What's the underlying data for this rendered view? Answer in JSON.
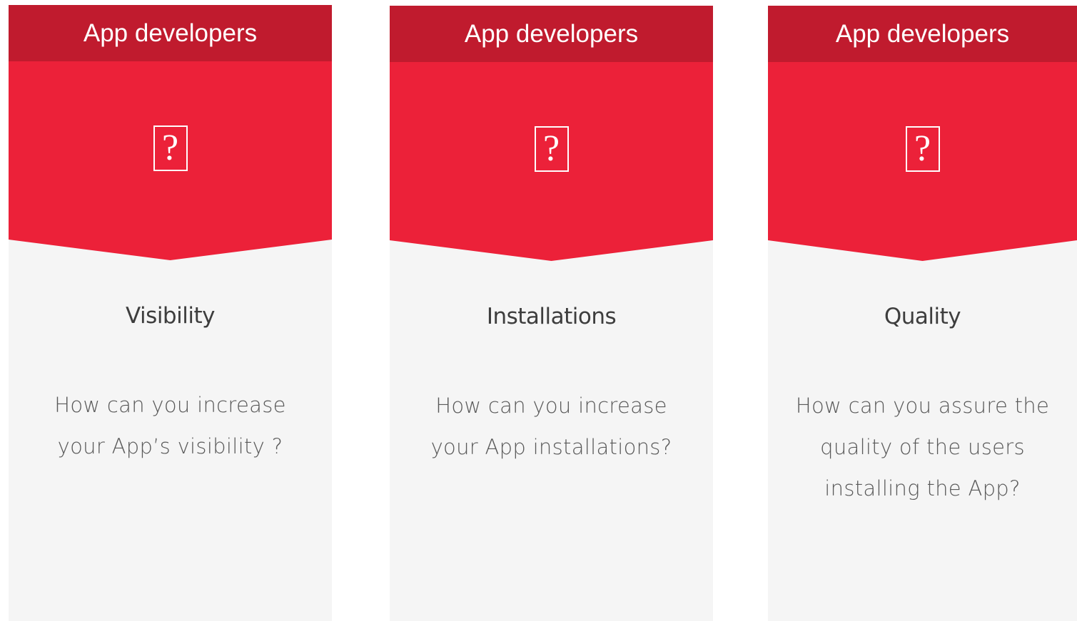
{
  "theme": {
    "header_color": "#c01b2e",
    "banner_color": "#ec2139",
    "card_background": "#f5f5f5",
    "title_color": "#3d3d3d",
    "text_color": "#595959"
  },
  "cards": [
    {
      "header": "App developers",
      "icon": "question-mark-icon",
      "icon_glyph": "?",
      "title": "Visibility",
      "description_lines": [
        "How can you increase",
        "your App’s visibility ?"
      ]
    },
    {
      "header": "App developers",
      "icon": "question-mark-icon",
      "icon_glyph": "?",
      "title": "Installations",
      "description_lines": [
        "How can you increase",
        "your App installations?"
      ]
    },
    {
      "header": "App developers",
      "icon": "question-mark-icon",
      "icon_glyph": "?",
      "title": "Quality",
      "description_lines": [
        "How can you assure the",
        "quality of the users",
        "installing the App?"
      ]
    }
  ]
}
